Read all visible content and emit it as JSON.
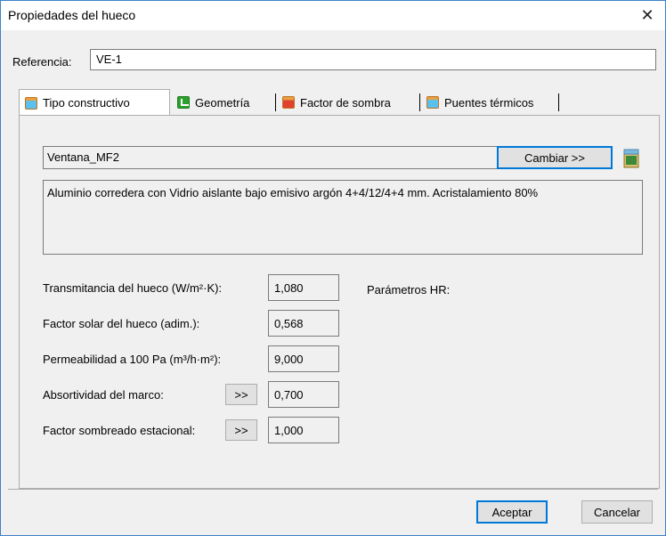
{
  "window": {
    "title": "Propiedades del hueco",
    "close_glyph": "✕"
  },
  "reference": {
    "label": "Referencia:",
    "value": "VE-1"
  },
  "tabs": [
    {
      "label": "Tipo constructivo",
      "icon": "window-icon",
      "active": true
    },
    {
      "label": "Geometría",
      "icon": "geometry-icon",
      "active": false
    },
    {
      "label": "Factor de sombra",
      "icon": "shade-icon",
      "active": false
    },
    {
      "label": "Puentes térmicos",
      "icon": "thermal-bridge-icon",
      "active": false
    }
  ],
  "construction": {
    "name": "Ventana_MF2",
    "change_label": "Cambiar >>",
    "description": "Aluminio corredera con Vidrio aislante bajo emisivo argón 4+4/12/4+4 mm. Acristalamiento 80%"
  },
  "params": [
    {
      "label": "Transmitancia del hueco (W/m²·K):",
      "value": "1,080"
    },
    {
      "label": "Factor solar del hueco (adim.):",
      "value": "0,568"
    },
    {
      "label": "Permeabilidad a 100 Pa (m³/h·m²):",
      "value": "9,000"
    },
    {
      "label": "Absortividad del marco:",
      "value": "0,700",
      "button": ">>"
    },
    {
      "label": "Factor sombreado estacional:",
      "value": "1,000",
      "button": ">>"
    }
  ],
  "hr_label": "Parámetros HR:",
  "buttons": {
    "accept": "Aceptar",
    "cancel": "Cancelar"
  },
  "colors": {
    "accent": "#0078d7",
    "window_border": "#3c82c8"
  }
}
